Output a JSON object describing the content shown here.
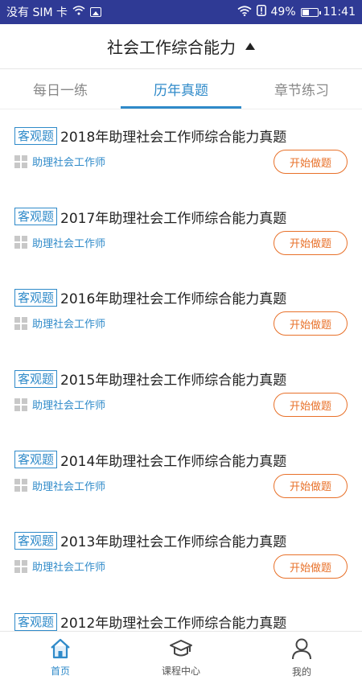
{
  "status_bar": {
    "carrier": "没有 SIM 卡",
    "battery_percent": "49%",
    "time": "11:41"
  },
  "header": {
    "title": "社会工作综合能力"
  },
  "tabs": [
    {
      "label": "每日一练",
      "active": false
    },
    {
      "label": "历年真题",
      "active": true
    },
    {
      "label": "章节练习",
      "active": false
    }
  ],
  "list": {
    "items": [
      {
        "tag": "客观题",
        "title": "2018年助理社会工作师综合能力真题",
        "category": "助理社会工作师",
        "button": "开始做题"
      },
      {
        "tag": "客观题",
        "title": "2017年助理社会工作师综合能力真题",
        "category": "助理社会工作师",
        "button": "开始做题"
      },
      {
        "tag": "客观题",
        "title": "2016年助理社会工作师综合能力真题",
        "category": "助理社会工作师",
        "button": "开始做题"
      },
      {
        "tag": "客观题",
        "title": "2015年助理社会工作师综合能力真题",
        "category": "助理社会工作师",
        "button": "开始做题"
      },
      {
        "tag": "客观题",
        "title": "2014年助理社会工作师综合能力真题",
        "category": "助理社会工作师",
        "button": "开始做题"
      },
      {
        "tag": "客观题",
        "title": "2013年助理社会工作师综合能力真题",
        "category": "助理社会工作师",
        "button": "开始做题"
      },
      {
        "tag": "客观题",
        "title": "2012年助理社会工作师综合能力真题",
        "category": "",
        "button": ""
      }
    ]
  },
  "bottom_nav": [
    {
      "label": "首页",
      "icon": "home-icon",
      "active": true
    },
    {
      "label": "课程中心",
      "icon": "graduation-cap-icon",
      "active": false
    },
    {
      "label": "我的",
      "icon": "user-icon",
      "active": false
    }
  ],
  "colors": {
    "status_bar": "#2f3a95",
    "accent_blue": "#2f8ac9",
    "accent_orange": "#e8712a"
  }
}
